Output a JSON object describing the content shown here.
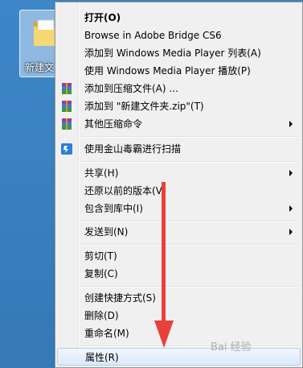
{
  "desktop": {
    "folder_label": "新建文"
  },
  "menu": {
    "items": [
      {
        "label": "打开(O)",
        "bold": true
      },
      {
        "label": "Browse in Adobe Bridge CS6"
      },
      {
        "label": "添加到 Windows Media Player 列表(A)"
      },
      {
        "label": "使用 Windows Media Player 播放(P)"
      },
      {
        "label": "添加到压缩文件(A) ...",
        "icon": "winrar-icon"
      },
      {
        "label": "添加到 \"新建文件夹.zip\"(T)",
        "icon": "winrar-icon"
      },
      {
        "label": "其他压缩命令",
        "icon": "winrar-icon",
        "submenu": true
      },
      {
        "label": "使用金山毒霸进行扫描",
        "icon": "kingsoft-antivirus-icon"
      },
      {
        "label": "共享(H)",
        "submenu": true
      },
      {
        "label": "还原以前的版本(V)"
      },
      {
        "label": "包含到库中(I)",
        "submenu": true
      },
      {
        "label": "发送到(N)",
        "submenu": true
      },
      {
        "label": "剪切(T)"
      },
      {
        "label": "复制(C)"
      },
      {
        "label": "创建快捷方式(S)"
      },
      {
        "label": "删除(D)"
      },
      {
        "label": "重命名(M)"
      },
      {
        "label": "属性(R)",
        "highlighted": true
      }
    ]
  },
  "watermark": "Bai 经验",
  "colors": {
    "desktop": "#3a82c2",
    "menu_bg": "#f0f0f0",
    "highlight": "#dbe9fa",
    "arrow": "#e8413c"
  }
}
